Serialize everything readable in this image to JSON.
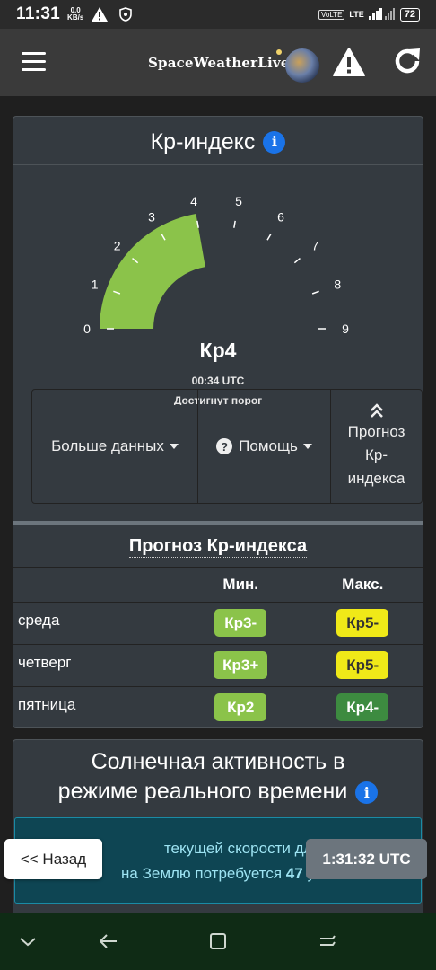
{
  "status_bar": {
    "time": "11:31",
    "speed_top": "0.0",
    "speed_bottom": "KB/s",
    "volte": "VoLTE",
    "lte": "LTE",
    "battery": "72"
  },
  "header": {
    "logo_text": "SpaceWeatherLive"
  },
  "kp_card": {
    "title": "Кр-индекс",
    "info_icon": "i",
    "gauge": {
      "labels": [
        "0",
        "1",
        "2",
        "3",
        "4",
        "5",
        "6",
        "7",
        "8",
        "9"
      ],
      "value": 4,
      "max": 9,
      "fill_color": "#8bc34a",
      "current": "Кр4",
      "time": "00:34 UTC",
      "note": "Достигнут порог"
    },
    "buttons": {
      "more_data": "Больше данных",
      "help_icon": "?",
      "help": "Помощь",
      "forecast_line1": "Прогноз",
      "forecast_line2": "Кр-",
      "forecast_line3": "индекса"
    },
    "forecast": {
      "title": "Прогноз Кр-индекса",
      "col_min": "Мин.",
      "col_max": "Макс.",
      "rows": [
        {
          "day": "среда",
          "min": "Кр3-",
          "max": "Кр5-"
        },
        {
          "day": "четверг",
          "min": "Кр3+",
          "max": "Кр5-"
        },
        {
          "day": "пятница",
          "min": "Кр2",
          "max": "Кр4-"
        }
      ]
    }
  },
  "solar_card": {
    "title_line1": "Солнечная активность в",
    "title_line2": "режиме реального времени",
    "info_icon": "i",
    "info_line1": "текущей скорости для пр",
    "info_line2_prefix": "на Землю потребуется",
    "info_line2_bold": "47",
    "info_line2_suffix": "у"
  },
  "floating": {
    "back": "<< Назад",
    "clock": "1:31:32 UTC"
  },
  "colors": {
    "card_bg": "#343a40",
    "page_bg": "#1f1f1f",
    "header_bg": "#3a3a3a",
    "pill_light_green": "#8bc34a",
    "pill_yellow": "#f0e918",
    "pill_dark_green": "#3d8b40",
    "info_blue": "#1a73e8"
  }
}
